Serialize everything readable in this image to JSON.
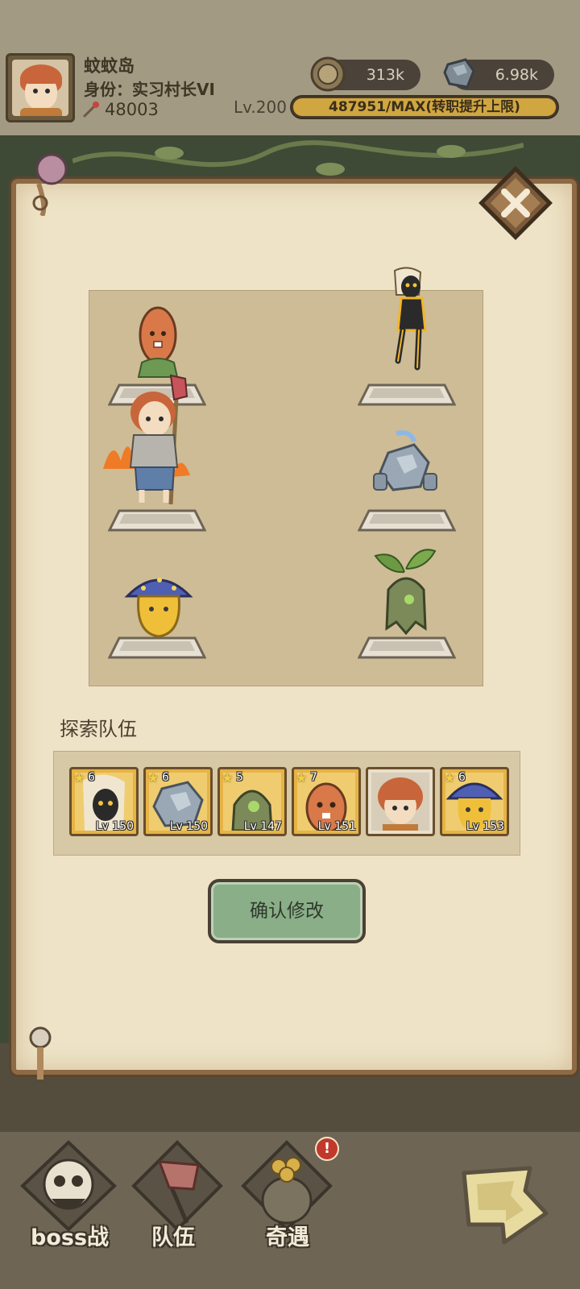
{
  "player": {
    "name": "蚊蚊岛",
    "title": "身份：实习村长VI",
    "power": "48003",
    "level": "Lv.200",
    "exp_text": "487951/MAX(转职提升上限)",
    "exp_progress": 1.0
  },
  "resources": {
    "coins": "313k",
    "gems": "6.98k"
  },
  "panel": {
    "team_label": "探索队伍",
    "confirm_label": "确认修改"
  },
  "team": [
    {
      "stars": "6",
      "level": "Lv 150",
      "unit": "shadow-girl"
    },
    {
      "stars": "6",
      "level": "Lv 150",
      "unit": "rock-golem"
    },
    {
      "stars": "5",
      "level": "Lv 147",
      "unit": "sprout-spirit"
    },
    {
      "stars": "7",
      "level": "Lv 151",
      "unit": "carrot-monster"
    },
    {
      "stars": "",
      "level": "",
      "unit": "hero-boy"
    },
    {
      "stars": "6",
      "level": "Lv 153",
      "unit": "mushroom-spirit"
    }
  ],
  "nav": {
    "boss": "boss战",
    "team": "队伍",
    "encounter": "奇遇",
    "encounter_badge": "!"
  },
  "colors": {
    "parchment": "#eee3c6",
    "confirm_button": "#8aae88",
    "exp_fill": "#d0a640"
  }
}
